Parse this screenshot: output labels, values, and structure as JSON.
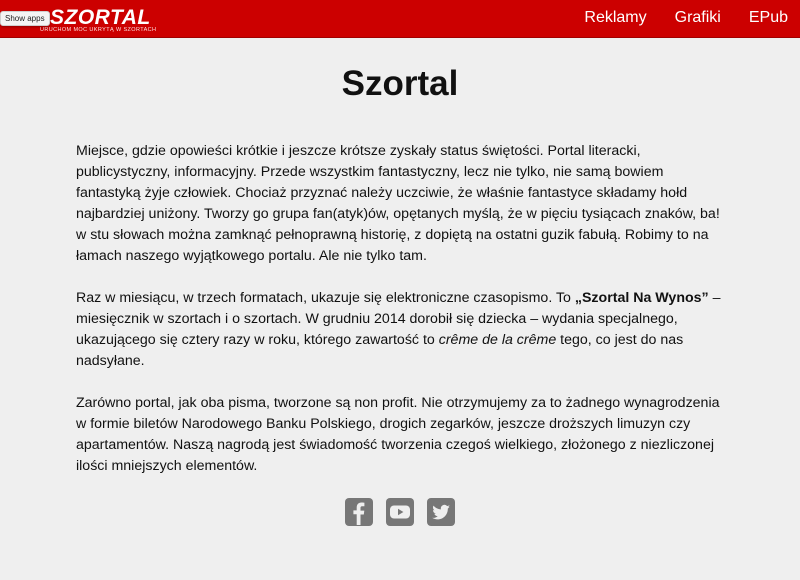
{
  "header": {
    "logo_mark": "≡",
    "logo_title": "SZORTAL",
    "logo_tagline": "URUCHOM MOC UKRYTĄ W SZORTACH",
    "show_apps_label": "Show apps",
    "nav": [
      {
        "label": "Reklamy"
      },
      {
        "label": "Grafiki"
      },
      {
        "label": "EPub"
      }
    ],
    "brand_color": "#cc0000"
  },
  "main": {
    "title": "Szortal",
    "paragraphs": [
      {
        "text": "Miejsce, gdzie opowieści krótkie i jeszcze krótsze zyskały status świętości. Portal literacki, publicystyczny, informacyjny. Przede wszystkim fantastyczny, lecz nie tylko, nie samą bowiem fantastyką żyje człowiek. Chociaż przyznać należy uczciwie, że właśnie fantastyce składamy hołd najbardziej uniżony. Tworzy go grupa fan(atyk)ów, opętanych myślą, że w pięciu tysiącach znaków, ba! w stu słowach można zamknąć pełnoprawną historię, z dopiętą na ostatni guzik fabułą. Robimy to na łamach naszego wyjątkowego portalu. Ale nie tylko tam."
      },
      {
        "text_before": "Raz w miesiącu, w trzech formatach, ukazuje się elektroniczne czasopismo. To ",
        "bold": "„Szortal Na Wynos”",
        "text_middle": " – miesięcznik w szortach i o szortach. W grudniu 2014 dorobił się dziecka – wydania specjalnego, ukazującego się cztery razy w roku, którego zawartość to ",
        "italic": "crême de la crême",
        "text_after": " tego, co jest do nas nadsyłane."
      },
      {
        "text": "Zarówno portal, jak oba pisma, tworzone są non profit. Nie otrzymujemy za to żadnego wynagrodzenia w formie biletów Narodowego Banku Polskiego, drogich zegarków, jeszcze droższych limuzyn czy apartamentów. Naszą nagrodą jest świadomość tworzenia czegoś wielkiego, złożonego z niezliczonej ilości mniejszych elementów."
      }
    ]
  },
  "social": {
    "icons": [
      "facebook-icon",
      "youtube-icon",
      "twitter-icon"
    ],
    "icon_color": "#777777"
  }
}
